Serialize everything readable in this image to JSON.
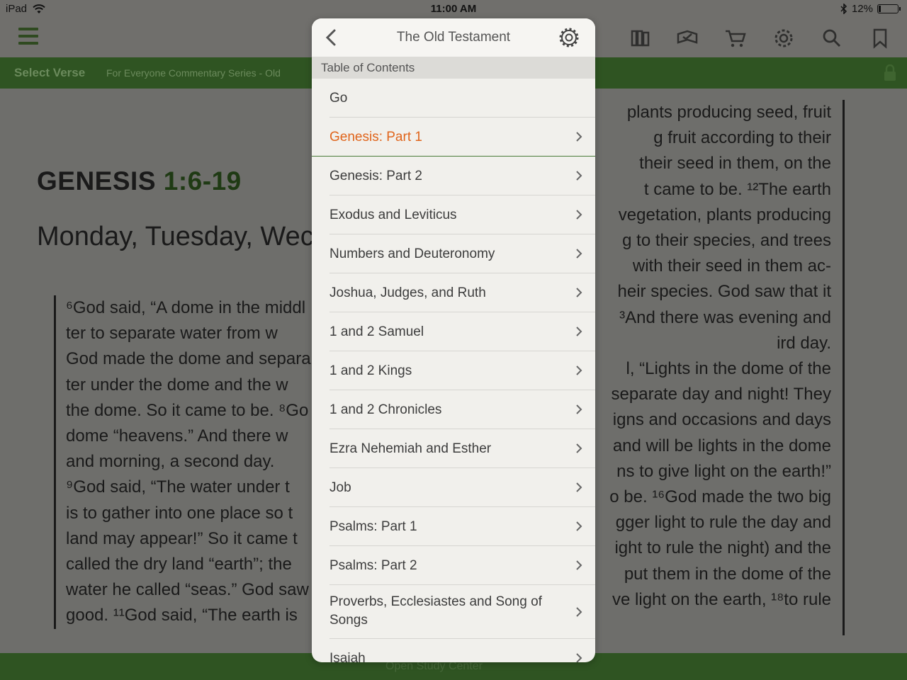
{
  "status_bar": {
    "device": "iPad",
    "time": "11:00 AM",
    "battery_percent": "12%",
    "battery_level": 0.12
  },
  "toolbar": {
    "icons": [
      "menu-icon",
      "library-icon",
      "study-icon",
      "cart-icon",
      "gear-icon",
      "search-icon",
      "bookmark-icon"
    ]
  },
  "greenbar": {
    "select_verse": "Select Verse",
    "series": "For Everyone Commentary Series - Old"
  },
  "reader": {
    "ref_book": "GENESIS",
    "ref_verses": "1:6-19",
    "title": "Monday, Tuesday, Wec",
    "left_lines": [
      "⁶God said, “A dome in the middl",
      "ter to separate water from w",
      "God made the dome and separa",
      "ter under the dome and the w",
      "the dome. So it came to be. ⁸Go",
      "dome “heavens.” And there w",
      "and morning, a second day.",
      "   ⁹God said, “The water under t",
      "is to gather into one place so t",
      "land may appear!” So it came t",
      "called the dry land “earth”; the",
      "water he called “seas.” God saw",
      "good. ¹¹God said, “The earth is"
    ],
    "right_lines": [
      "plants producing seed, fruit",
      "g fruit according to their",
      "their seed in them, on the",
      "t came to be. ¹²The earth",
      "vegetation, plants producing",
      "g to their species, and trees",
      "with their seed in them ac-",
      "heir species. God saw that it",
      "³And there was evening and",
      "ird day.",
      "l, “Lights in the dome of the",
      "separate day and night! They",
      "igns and occasions and days",
      "and will be lights in the dome",
      "ns to give light on the earth!”",
      "o be. ¹⁶God made the two big",
      "gger light to rule the day and",
      "ight to rule the night) and the",
      "put them in the dome of the",
      "ve light on the earth, ¹⁸to rule"
    ]
  },
  "bottombar": {
    "label": "Open Study Center"
  },
  "popover": {
    "title": "The Old Testament",
    "section": "Table of Contents",
    "go": "Go",
    "items": [
      {
        "label": "Genesis: Part 1",
        "active": true
      },
      {
        "label": "Genesis: Part 2"
      },
      {
        "label": "Exodus and Leviticus"
      },
      {
        "label": "Numbers and Deuteronomy"
      },
      {
        "label": "Joshua, Judges, and Ruth"
      },
      {
        "label": "1 and 2 Samuel"
      },
      {
        "label": "1 and 2 Kings"
      },
      {
        "label": "1 and 2 Chronicles"
      },
      {
        "label": "Ezra Nehemiah and Esther"
      },
      {
        "label": "Job"
      },
      {
        "label": "Psalms: Part 1"
      },
      {
        "label": "Psalms: Part 2"
      },
      {
        "label": "Proverbs, Ecclesiastes and Song of Songs"
      },
      {
        "label": "Isaiah"
      }
    ]
  },
  "colors": {
    "accent": "#e0651c",
    "brand_green": "#4a7c3a",
    "overlay_gray": "#6e6e6b"
  }
}
